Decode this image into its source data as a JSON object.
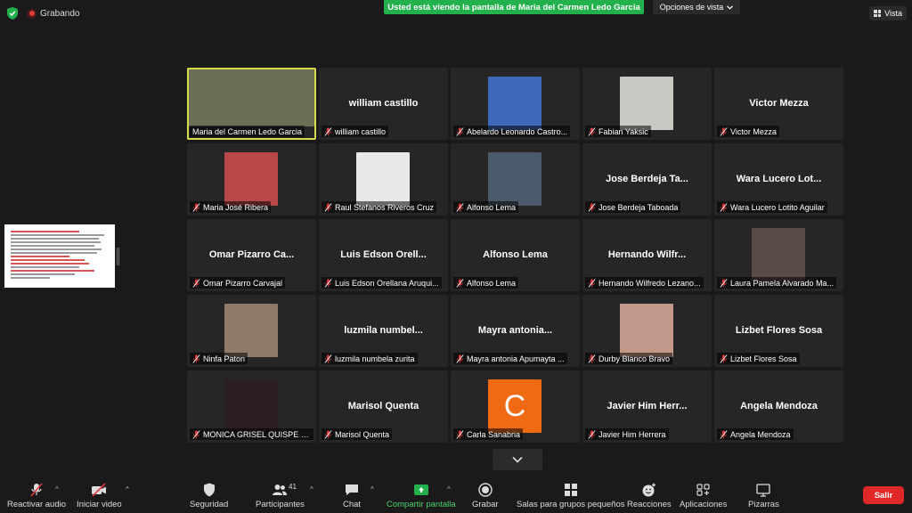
{
  "top": {
    "recording_label": "Grabando",
    "share_banner": "Usted está viendo la pantalla de Maria del Carmen Ledo Garcia",
    "view_options": "Opciones de vista",
    "vista_label": "Vista"
  },
  "participants": [
    {
      "caption": "Maria del Carmen Ledo Garcia",
      "display": "",
      "video": true,
      "active": true,
      "muted": false,
      "color": "#6b6e55"
    },
    {
      "caption": "william castillo",
      "display": "william castillo",
      "video": false,
      "muted": true
    },
    {
      "caption": "Abelardo Leonardo Castro...",
      "display": "",
      "video": true,
      "muted": true,
      "color": "#3d69b8"
    },
    {
      "caption": "Fabian Yaksic",
      "display": "",
      "video": true,
      "muted": true,
      "color": "#c9c9c3"
    },
    {
      "caption": "Victor Mezza",
      "display": "Victor Mezza",
      "video": false,
      "muted": true
    },
    {
      "caption": "Maria José Ribera",
      "display": "",
      "video": true,
      "muted": true,
      "color": "#b8474a"
    },
    {
      "caption": "Raul Stefanos Riveros Cruz",
      "display": "",
      "video": true,
      "muted": true,
      "color": "#e8e8e8"
    },
    {
      "caption": "Alfonso Lema",
      "display": "",
      "video": true,
      "muted": true,
      "color": "#4a5a6a"
    },
    {
      "caption": "Jose Berdeja Taboada",
      "display": "Jose Berdeja Ta...",
      "video": false,
      "muted": true
    },
    {
      "caption": "Wara Lucero Lotito Aguilar",
      "display": "Wara Lucero Lot...",
      "video": false,
      "muted": true
    },
    {
      "caption": "Omar Pizarro Carvajal",
      "display": "Omar Pizarro Ca...",
      "video": false,
      "muted": true
    },
    {
      "caption": "Luis Edson Orellana Aruqui...",
      "display": "Luis Edson Orell...",
      "video": false,
      "muted": true
    },
    {
      "caption": "Alfonso Lema",
      "display": "Alfonso Lema",
      "video": false,
      "muted": true
    },
    {
      "caption": "Hernando Wilfredo Lezano...",
      "display": "Hernando Wilfr...",
      "video": false,
      "muted": true
    },
    {
      "caption": "Laura Pamela Alvarado Ma...",
      "display": "",
      "video": true,
      "muted": true,
      "color": "#5a4a48"
    },
    {
      "caption": "Ninfa Paton",
      "display": "",
      "video": true,
      "muted": true,
      "color": "#8f7a6a"
    },
    {
      "caption": "luzmila numbela zurita",
      "display": "luzmila numbel...",
      "video": false,
      "muted": true
    },
    {
      "caption": "Mayra antonia Apumayta ...",
      "display": "Mayra antonia...",
      "video": false,
      "muted": true
    },
    {
      "caption": "Durby Blanco Bravo",
      "display": "",
      "video": true,
      "muted": true,
      "color": "#c39a8a"
    },
    {
      "caption": "Lizbet Flores Sosa",
      "display": "Lizbet Flores Sosa",
      "video": false,
      "muted": true
    },
    {
      "caption": "MONICA GRISEL QUISPE C...",
      "display": "",
      "video": true,
      "muted": true,
      "color": "#2a1e22"
    },
    {
      "caption": "Marisol Quenta",
      "display": "Marisol Quenta",
      "video": false,
      "muted": true
    },
    {
      "caption": "Carla Sanabria",
      "display": "",
      "video": false,
      "letter": "C",
      "muted": true,
      "color": "#f06a14"
    },
    {
      "caption": "Javier Him Herrera",
      "display": "Javier Him Herr...",
      "video": false,
      "muted": true
    },
    {
      "caption": "Angela Mendoza",
      "display": "Angela Mendoza",
      "video": false,
      "muted": true
    }
  ],
  "toolbar": {
    "unmute": "Reactivar audio",
    "start_video": "Iniciar video",
    "security": "Seguridad",
    "participants": "Participantes",
    "participants_count": "41",
    "chat": "Chat",
    "share": "Compartir pantalla",
    "record": "Grabar",
    "breakout": "Salas para grupos pequeños",
    "reactions": "Reacciones",
    "apps": "Aplicaciones",
    "whiteboards": "Pizarras",
    "leave": "Salir"
  }
}
